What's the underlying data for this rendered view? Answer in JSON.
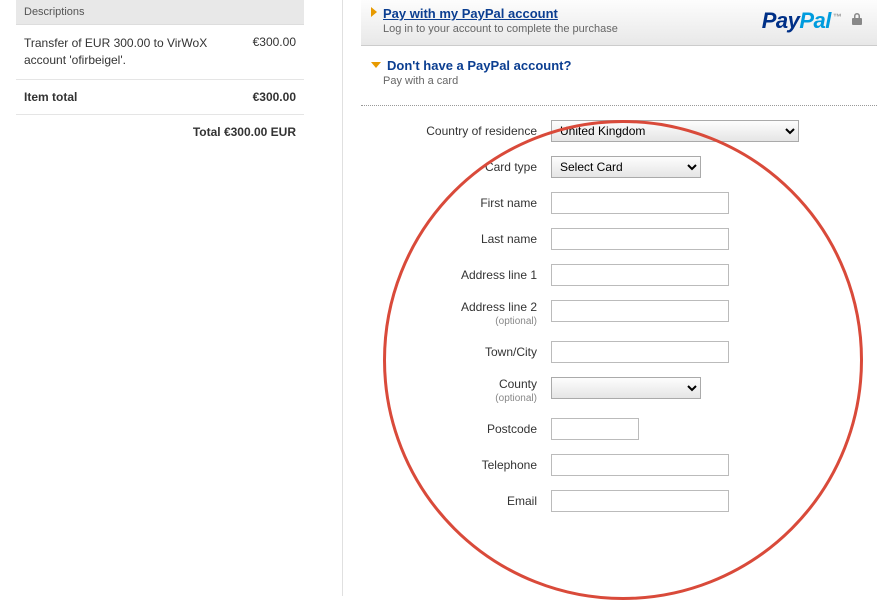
{
  "sidebar": {
    "header_label": "Descriptions",
    "line_item_desc": "Transfer of EUR 300.00 to VirWoX account 'ofirbeigel'.",
    "line_item_price": "€300.00",
    "item_total_label": "Item total",
    "item_total_price": "€300.00",
    "grand_total_label": "Total",
    "grand_total_value": "€300.00 EUR"
  },
  "brand": {
    "pay": "Pay",
    "pal": "Pal",
    "tm": "™"
  },
  "accordion": {
    "login_title": "Pay with my PayPal account",
    "login_sub": "Log in to your account to complete the purchase",
    "guest_title": "Don't have a PayPal account?",
    "guest_sub": "Pay with a card"
  },
  "form": {
    "country_label": "Country of residence",
    "country_value": "United Kingdom",
    "card_type_label": "Card type",
    "card_type_value": "Select Card",
    "first_name_label": "First name",
    "last_name_label": "Last name",
    "address1_label": "Address line 1",
    "address2_label": "Address line 2",
    "optional_text": "(optional)",
    "town_label": "Town/City",
    "county_label": "County",
    "postcode_label": "Postcode",
    "telephone_label": "Telephone",
    "email_label": "Email"
  }
}
